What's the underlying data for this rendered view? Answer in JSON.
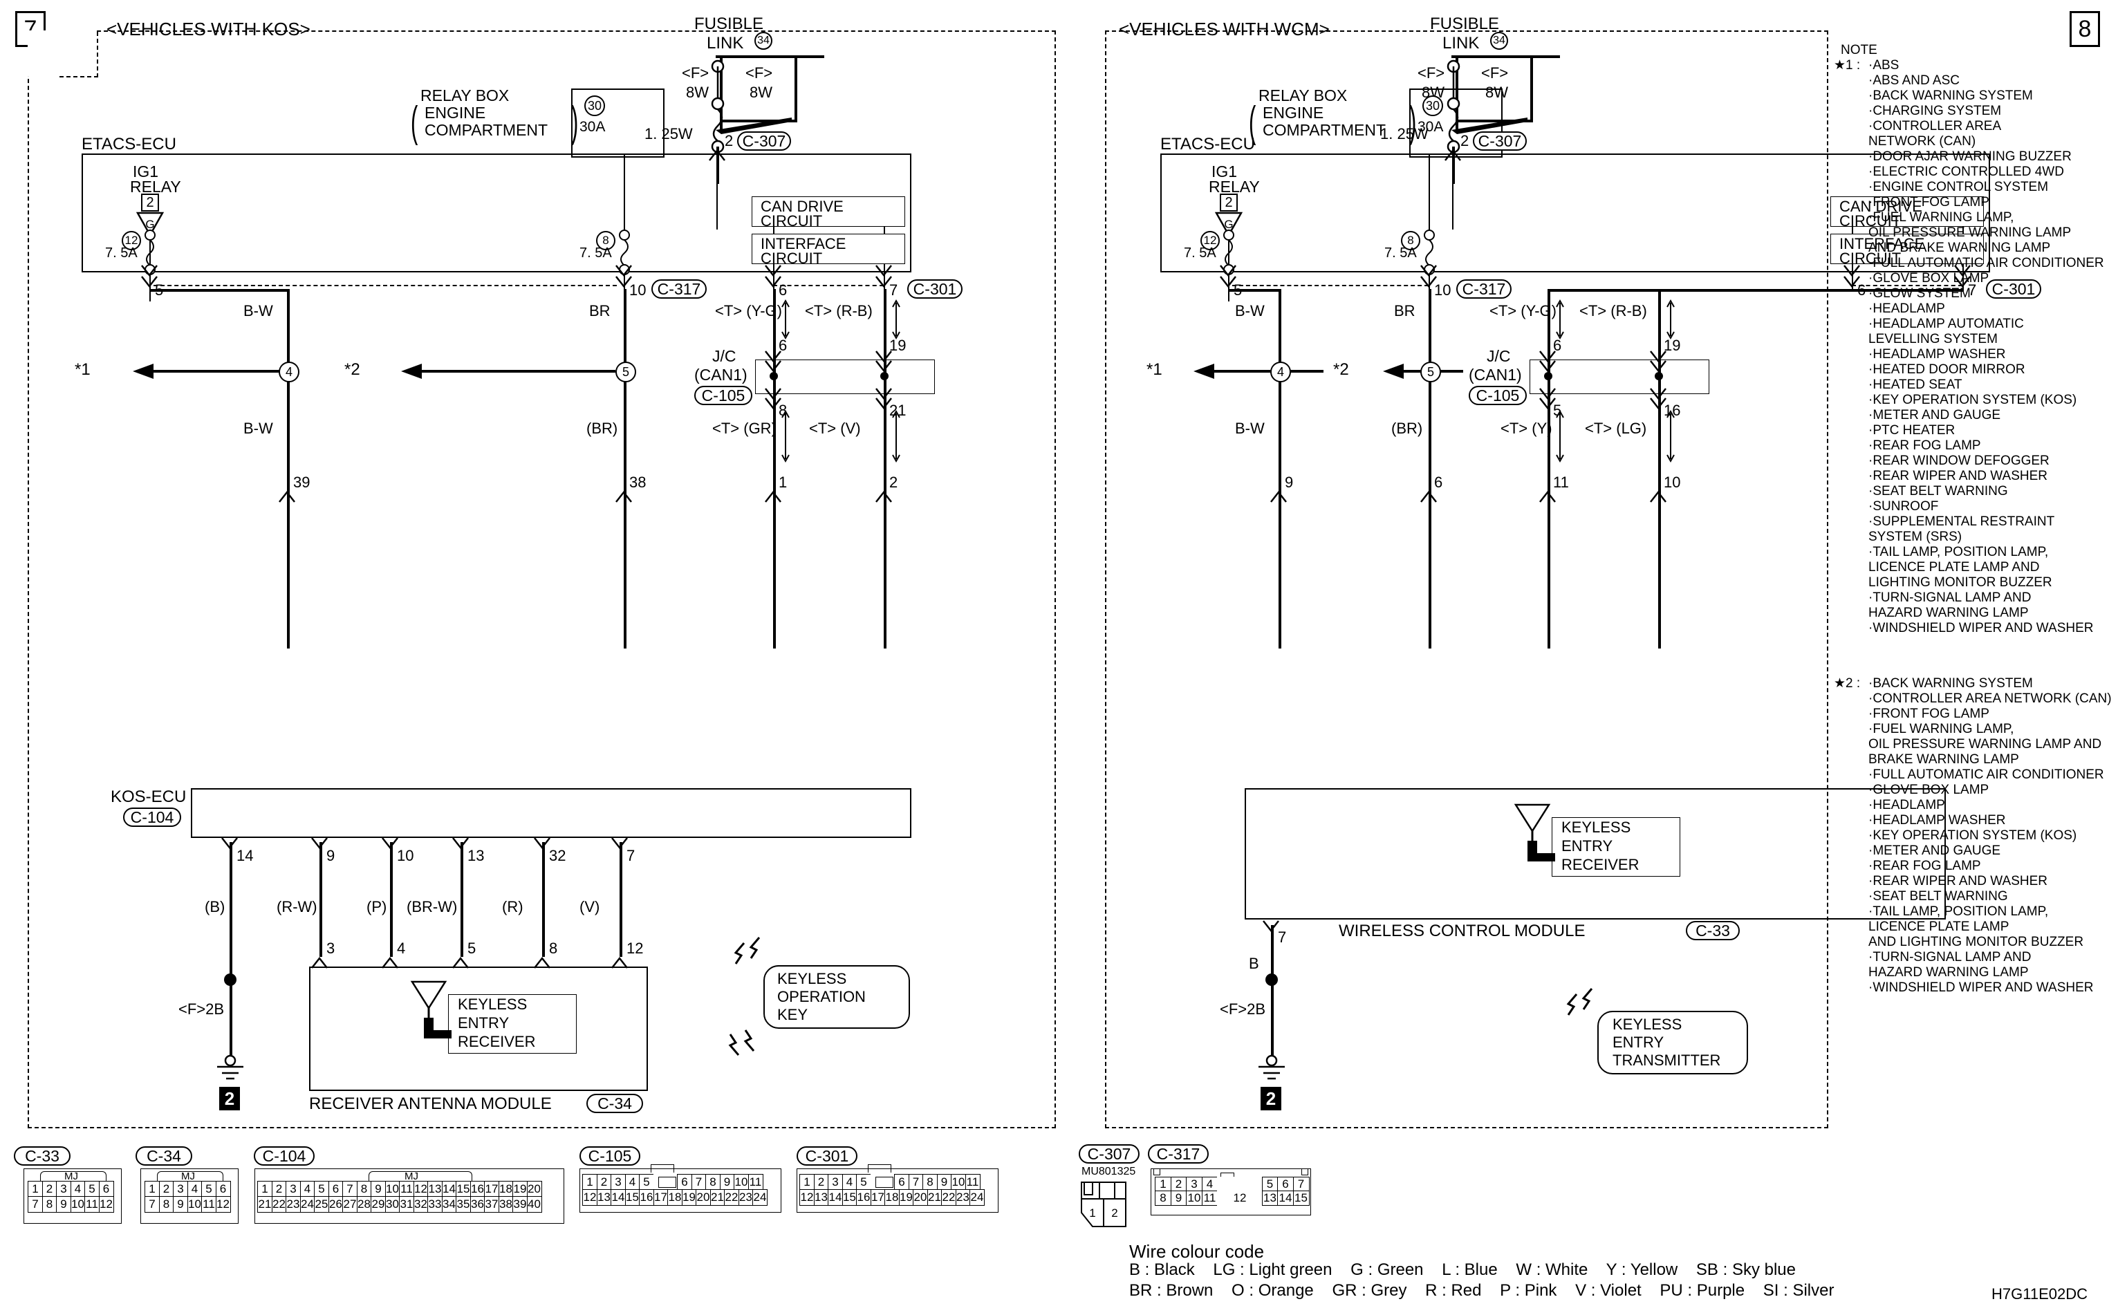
{
  "document_id": "H7G11E02DC",
  "panels": [
    {
      "number": "7",
      "title": "<VEHICLES WITH KOS>",
      "fusible_link": {
        "label_line1": "FUSIBLE",
        "label_line2": "LINK",
        "circle": "34"
      },
      "fuse_branches": [
        {
          "type": "<F>",
          "rating": "8W"
        },
        {
          "type": "<F>",
          "rating": "8W"
        }
      ],
      "relay_box": {
        "line1": "RELAY BOX",
        "line2": "ENGINE",
        "line3": "COMPARTMENT",
        "fuse_circle": "30",
        "fuse_amp": "30A"
      },
      "main_wire": {
        "size": "1. 25W",
        "pin": "2",
        "connector": "C-307"
      },
      "ecu_title": "ETACS-ECU",
      "ig1_relay": {
        "label1": "IG1",
        "label2": "RELAY",
        "square": "2",
        "triangle": "G"
      },
      "fuses": [
        {
          "circle": "12",
          "amp": "7. 5A"
        },
        {
          "circle": "8",
          "amp": "7. 5A"
        }
      ],
      "internal_blocks": [
        {
          "line1": "CAN DRIVE",
          "line2": "CIRCUIT"
        },
        {
          "line1": "INTERFACE",
          "line2": "CIRCUIT"
        }
      ],
      "ecu_out_pins": [
        {
          "pin": "5",
          "connector": ""
        },
        {
          "pin": "10",
          "connector": "C-317"
        },
        {
          "pin": "6",
          "connector": ""
        },
        {
          "pin": "7",
          "connector": "C-301"
        }
      ],
      "wire_labels_upper": [
        "B-W",
        "BR",
        "<T> (Y-G)",
        "<T> (R-B)"
      ],
      "splices": [
        {
          "ref": "*1",
          "circle": "4"
        },
        {
          "ref": "*2",
          "circle": "5"
        }
      ],
      "wire_labels_lower": [
        "B-W",
        "(BR)",
        "<T> (GR)",
        "<T> (V)"
      ],
      "jc": {
        "line1": "J/C",
        "line2": "(CAN1)",
        "connector": "C-105",
        "top_pins": [
          "6",
          "19"
        ],
        "bottom_pins": [
          "8",
          "21"
        ],
        "ecu_side_pins": [
          "6",
          "7"
        ]
      },
      "module_in_pins": [
        "39",
        "38",
        "1",
        "2"
      ],
      "module_title": "KOS-ECU",
      "module_connector": "C-104",
      "module_out": [
        {
          "top": "14",
          "colour": "(B)",
          "bottom": ""
        },
        {
          "top": "9",
          "colour": "(R-W)",
          "bottom": "3"
        },
        {
          "top": "10",
          "colour": "(P)",
          "bottom": "4"
        },
        {
          "top": "13",
          "colour": "(BR-W)",
          "bottom": "5"
        },
        {
          "top": "32",
          "colour": "(R)",
          "bottom": "8"
        },
        {
          "top": "7",
          "colour": "(V)",
          "bottom": "12"
        }
      ],
      "ground": {
        "label": "<F>2B",
        "id": "2"
      },
      "receiver_box": {
        "line1": "KEYLESS",
        "line2": "ENTRY",
        "line3": "RECEIVER"
      },
      "antenna_module": {
        "title": "RECEIVER ANTENNA MODULE",
        "connector": "C-34"
      },
      "wireless_device": {
        "line1": "KEYLESS",
        "line2": "OPERATION",
        "line3": "KEY"
      }
    },
    {
      "number": "8",
      "title": "<VEHICLES WITH WCM>",
      "fusible_link": {
        "label_line1": "FUSIBLE",
        "label_line2": "LINK",
        "circle": "34"
      },
      "fuse_branches": [
        {
          "type": "<F>",
          "rating": "8W"
        },
        {
          "type": "<F>",
          "rating": "8W"
        }
      ],
      "relay_box": {
        "line1": "RELAY BOX",
        "line2": "ENGINE",
        "line3": "COMPARTMENT",
        "fuse_circle": "30",
        "fuse_amp": "30A"
      },
      "main_wire": {
        "size": "1. 25W",
        "pin": "2",
        "connector": "C-307"
      },
      "ecu_title": "ETACS-ECU",
      "ig1_relay": {
        "label1": "IG1",
        "label2": "RELAY",
        "square": "2",
        "triangle": "G"
      },
      "fuses": [
        {
          "circle": "12",
          "amp": "7. 5A"
        },
        {
          "circle": "8",
          "amp": "7. 5A"
        }
      ],
      "internal_blocks": [
        {
          "line1": "CAN DRIVE",
          "line2": "CIRCUIT"
        },
        {
          "line1": "INTERFACE",
          "line2": "CIRCUIT"
        }
      ],
      "ecu_out_pins": [
        {
          "pin": "5",
          "connector": ""
        },
        {
          "pin": "10",
          "connector": "C-317"
        },
        {
          "pin": "6",
          "connector": ""
        },
        {
          "pin": "7",
          "connector": "C-301"
        }
      ],
      "wire_labels_upper": [
        "B-W",
        "BR",
        "<T> (Y-G)",
        "<T> (R-B)"
      ],
      "splices": [
        {
          "ref": "*1",
          "circle": "4"
        },
        {
          "ref": "*2",
          "circle": "5"
        }
      ],
      "wire_labels_lower": [
        "B-W",
        "(BR)",
        "<T> (Y)",
        "<T> (LG)"
      ],
      "jc": {
        "line1": "J/C",
        "line2": "(CAN1)",
        "connector": "C-105",
        "top_pins": [
          "6",
          "19"
        ],
        "bottom_pins": [
          "5",
          "16"
        ],
        "ecu_side_pins": [
          "6",
          "7"
        ]
      },
      "module_in_pins": [
        "9",
        "6",
        "11",
        "10"
      ],
      "module_title": "WIRELESS CONTROL MODULE",
      "module_connector": "C-33",
      "ground_pin": "7",
      "ground_colour": "B",
      "ground": {
        "label": "<F>2B",
        "id": "2"
      },
      "receiver_box": {
        "line1": "KEYLESS",
        "line2": "ENTRY",
        "line3": "RECEIVER"
      },
      "wireless_device": {
        "line1": "KEYLESS",
        "line2": "ENTRY",
        "line3": "TRANSMITTER"
      }
    }
  ],
  "note": {
    "heading": "NOTE",
    "items": [
      {
        "marker": "★1 :",
        "lines": [
          "·ABS",
          "·ABS AND ASC",
          "·BACK WARNING SYSTEM",
          "·CHARGING SYSTEM",
          "·CONTROLLER AREA",
          " NETWORK (CAN)",
          "·DOOR AJAR WARNING BUZZER",
          "·ELECTRIC CONTROLLED 4WD",
          "·ENGINE CONTROL SYSTEM",
          "·FRONT FOG LAMP",
          "·FUEL WARNING LAMP,",
          " OIL PRESSURE WARNING LAMP",
          " AND BRAKE WARNING LAMP",
          "·FULL AUTOMATIC AIR CONDITIONER",
          "·GLOVE BOX LAMP",
          "·GLOW SYSTEM",
          "·HEADLAMP",
          "·HEADLAMP AUTOMATIC",
          " LEVELLING SYSTEM",
          "·HEADLAMP WASHER",
          "·HEATED DOOR MIRROR",
          "·HEATED SEAT",
          "·KEY OPERATION SYSTEM (KOS)",
          "·METER AND GAUGE",
          "·PTC HEATER",
          "·REAR FOG LAMP",
          "·REAR WINDOW DEFOGGER",
          "·REAR WIPER AND WASHER",
          "·SEAT BELT WARNING",
          "·SUNROOF",
          "·SUPPLEMENTAL RESTRAINT",
          " SYSTEM (SRS)",
          "·TAIL LAMP, POSITION LAMP,",
          " LICENCE PLATE LAMP AND",
          " LIGHTING MONITOR BUZZER",
          "·TURN-SIGNAL LAMP AND",
          " HAZARD WARNING LAMP",
          "·WINDSHIELD WIPER AND WASHER"
        ]
      },
      {
        "marker": "★2 :",
        "lines": [
          "·BACK WARNING SYSTEM",
          "·CONTROLLER AREA NETWORK (CAN)",
          "·FRONT FOG LAMP",
          "·FUEL WARNING LAMP,",
          " OIL PRESSURE WARNING LAMP AND",
          " BRAKE WARNING LAMP",
          "·FULL AUTOMATIC AIR CONDITIONER",
          "·GLOVE BOX LAMP",
          "·HEADLAMP",
          "·HEADLAMP WASHER",
          "·KEY OPERATION SYSTEM (KOS)",
          "·METER AND GAUGE",
          "·REAR FOG LAMP",
          "·REAR WIPER AND WASHER",
          "·SEAT BELT WARNING",
          "·TAIL LAMP, POSITION LAMP,",
          " LICENCE PLATE LAMP",
          " AND LIGHTING MONITOR BUZZER",
          "·TURN-SIGNAL LAMP AND",
          " HAZARD WARNING LAMP",
          "·WINDSHIELD WIPER AND WASHER"
        ]
      }
    ]
  },
  "connectors": [
    {
      "id": "C-33",
      "style": "MJ",
      "rows": [
        [
          "1",
          "2",
          "3",
          "4",
          "5",
          "6"
        ],
        [
          "7",
          "8",
          "9",
          "10",
          "11",
          "12"
        ]
      ]
    },
    {
      "id": "C-34",
      "style": "MJ",
      "rows": [
        [
          "1",
          "2",
          "3",
          "4",
          "5",
          "6"
        ],
        [
          "7",
          "8",
          "9",
          "10",
          "11",
          "12"
        ]
      ]
    },
    {
      "id": "C-104",
      "style": "MJ",
      "rows": [
        [
          "1",
          "2",
          "3",
          "4",
          "5",
          "6",
          "7",
          "8",
          "9",
          "10",
          "11",
          "12",
          "13",
          "14",
          "15",
          "16",
          "17",
          "18",
          "19",
          "20"
        ],
        [
          "21",
          "22",
          "23",
          "24",
          "25",
          "26",
          "27",
          "28",
          "29",
          "30",
          "31",
          "32",
          "33",
          "34",
          "35",
          "36",
          "37",
          "38",
          "39",
          "40"
        ]
      ]
    },
    {
      "id": "C-105",
      "style": "plain",
      "rows": [
        [
          "1",
          "2",
          "3",
          "4",
          "5",
          "",
          "6",
          "7",
          "8",
          "9",
          "10",
          "11"
        ],
        [
          "12",
          "13",
          "14",
          "15",
          "16",
          "17",
          "18",
          "19",
          "20",
          "21",
          "22",
          "23",
          "24"
        ]
      ]
    },
    {
      "id": "C-301",
      "style": "plain",
      "rows": [
        [
          "1",
          "2",
          "3",
          "4",
          "5",
          "",
          "6",
          "7",
          "8",
          "9",
          "10",
          "11"
        ],
        [
          "12",
          "13",
          "14",
          "15",
          "16",
          "17",
          "18",
          "19",
          "20",
          "21",
          "22",
          "23",
          "24"
        ]
      ]
    },
    {
      "id": "C-307",
      "style": "small",
      "part_number": "MU801325",
      "rows": [
        [
          "1",
          "2"
        ]
      ]
    },
    {
      "id": "C-317",
      "style": "split",
      "rows": [
        [
          "1",
          "2",
          "3",
          "4",
          "",
          "5",
          "6",
          "7"
        ],
        [
          "8",
          "9",
          "10",
          "11",
          "12",
          "13",
          "14",
          "15"
        ]
      ]
    }
  ],
  "wire_colour_code": {
    "title": "Wire colour code",
    "row1": [
      {
        "code": "B",
        "name": "Black"
      },
      {
        "code": "LG",
        "name": "Light green"
      },
      {
        "code": "G",
        "name": "Green"
      },
      {
        "code": "L",
        "name": "Blue"
      },
      {
        "code": "W",
        "name": "White"
      },
      {
        "code": "Y",
        "name": "Yellow"
      },
      {
        "code": "SB",
        "name": "Sky blue"
      }
    ],
    "row2": [
      {
        "code": "BR",
        "name": "Brown"
      },
      {
        "code": "O",
        "name": "Orange"
      },
      {
        "code": "GR",
        "name": "Grey"
      },
      {
        "code": "R",
        "name": "Red"
      },
      {
        "code": "P",
        "name": "Pink"
      },
      {
        "code": "V",
        "name": "Violet"
      },
      {
        "code": "PU",
        "name": "Purple"
      },
      {
        "code": "SI",
        "name": "Silver"
      }
    ],
    "row1_text": "B : Black    LG : Light green    G : Green    L : Blue    W : White    Y : Yellow    SB : Sky blue",
    "row2_text": "BR : Brown    O : Orange    GR : Grey    R : Red    P : Pink    V : Violet    PU : Purple    SI : Silver"
  }
}
